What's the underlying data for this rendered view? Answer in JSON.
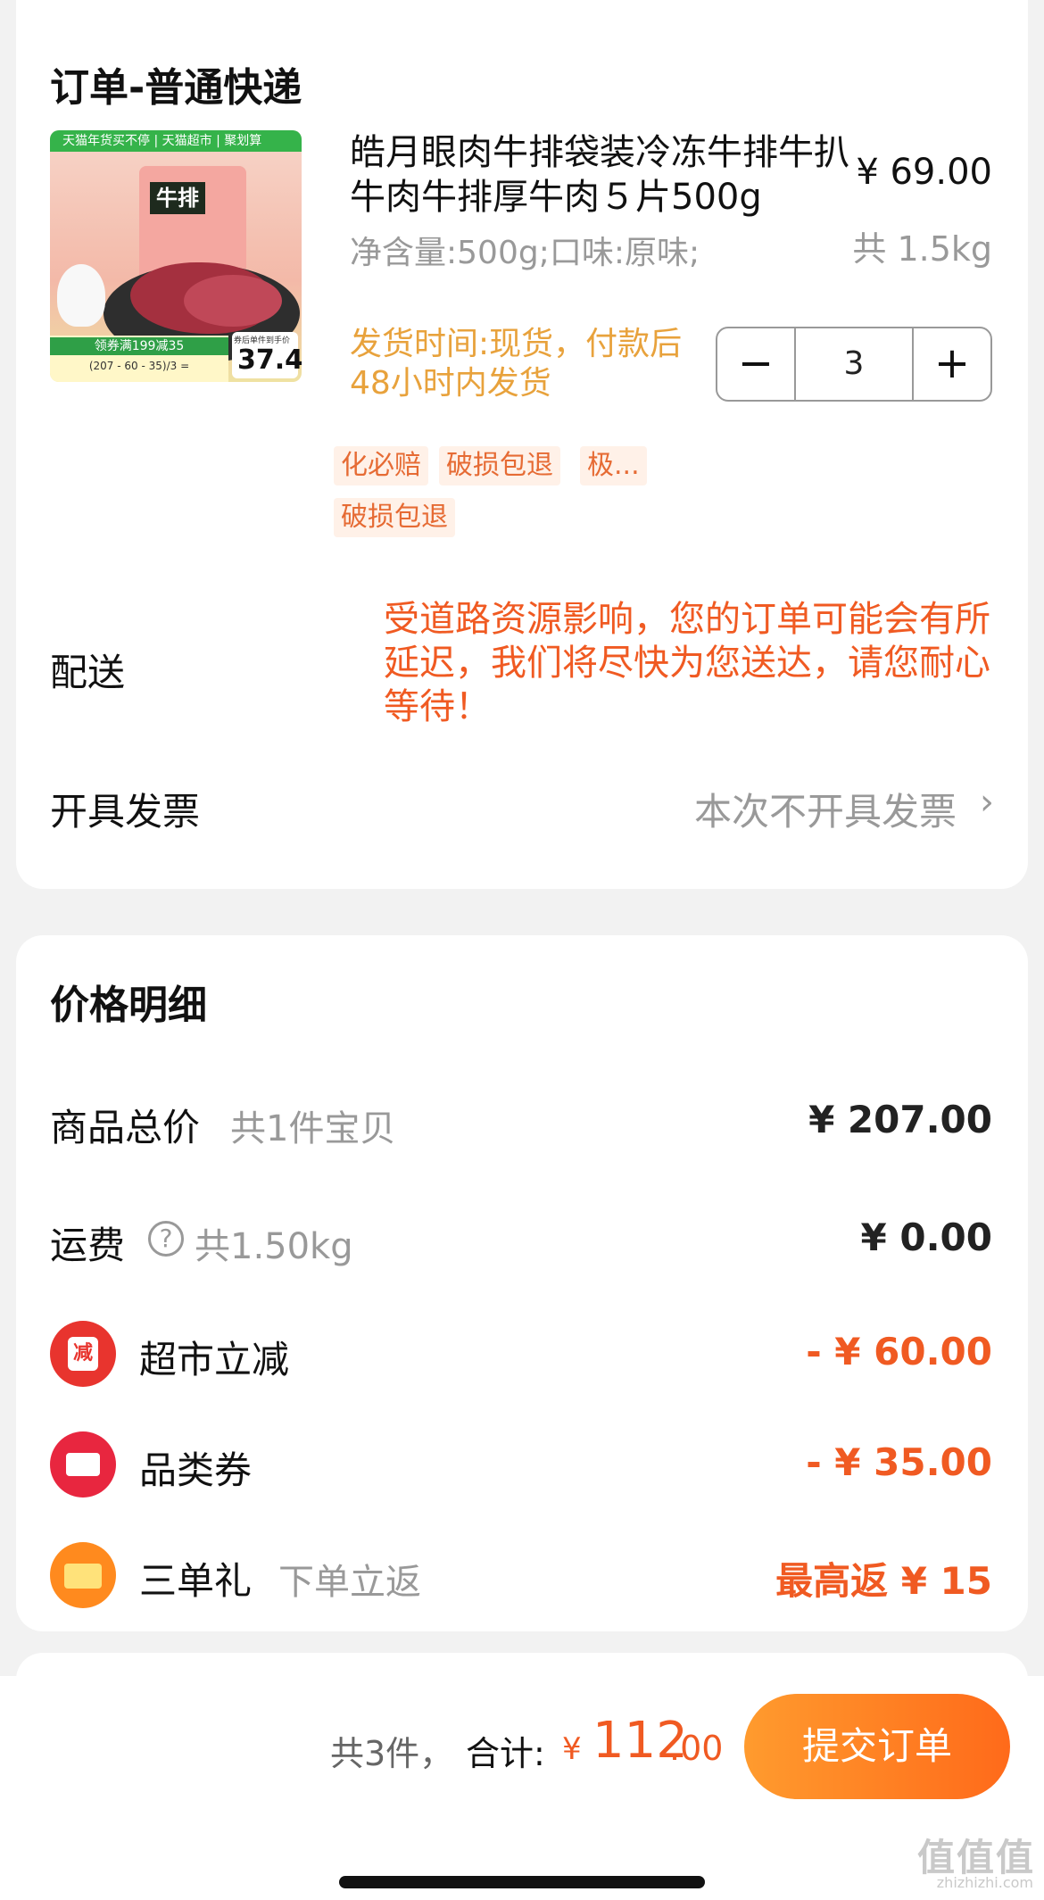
{
  "order": {
    "section_title": "订单-普通快递",
    "product": {
      "thumb_banner": "天猫年货买不停 | 天猫超市 | 聚划算",
      "thumb_bag_label": "牛排",
      "thumb_coupon": "领券满199减35",
      "thumb_coupon_calc": "(207 - 60 - 35)/3 =",
      "thumb_price_caption": "券后单件到手价",
      "thumb_price": "37.4",
      "name": "皓月眼肉牛排袋装冷冻牛排牛扒牛肉牛排厚牛肉５片500g",
      "price": "¥ 69.00",
      "weight": "共 1.5kg",
      "spec": "净含量:500g;口味:原味;",
      "shipping": "发货时间:现货，付款后48小时内发货",
      "quantity": "3",
      "minus": "−",
      "plus": "+",
      "tags": [
        "化必赔",
        "破损包退",
        "极...",
        "破损包退"
      ]
    },
    "delivery": {
      "label": "配送",
      "note": "受道路资源影响，您的订单可能会有所延迟，我们将尽快为您送达，请您耐心等待！"
    },
    "invoice": {
      "label": "开具发票",
      "value": "本次不开具发票",
      "chevron": "›"
    }
  },
  "price_detail": {
    "title": "价格明细",
    "rows": [
      {
        "label": "商品总价",
        "sub": "共1件宝贝",
        "value": "¥ 207.00"
      },
      {
        "label": "运费",
        "help": "?",
        "sub": "共1.50kg",
        "value": "¥ 0.00"
      },
      {
        "label": "超市立减",
        "icon": "减",
        "value": "- ¥ 60.00"
      },
      {
        "label": "品类券",
        "value": "- ¥ 35.00"
      },
      {
        "label": "三单礼",
        "sub": "下单立返",
        "value": "最高返 ¥ 15"
      }
    ]
  },
  "footer": {
    "count": "共3件，",
    "sum_label": "合计:",
    "currency": "¥",
    "total_int": "112",
    "total_dec": ".00",
    "submit": "提交订单"
  },
  "watermark": {
    "main": "值值值",
    "sub": "zhizhizhi.com"
  },
  "colors": {
    "accent": "#f05a22",
    "shipping": "#e8a23c",
    "submit_start": "#ff9b2e",
    "submit_end": "#ff6a1a",
    "tag_bg": "#fff1e8",
    "discount_icon": "#e8342e",
    "coupon_icon": "#e8263f",
    "gift_icon": "#ff8a1e"
  },
  "icons": {
    "discount": "reduce-badge-icon",
    "coupon": "ticket-icon",
    "gift": "envelope-icon",
    "help": "question-circle-icon",
    "chevron": "chevron-right-icon"
  }
}
